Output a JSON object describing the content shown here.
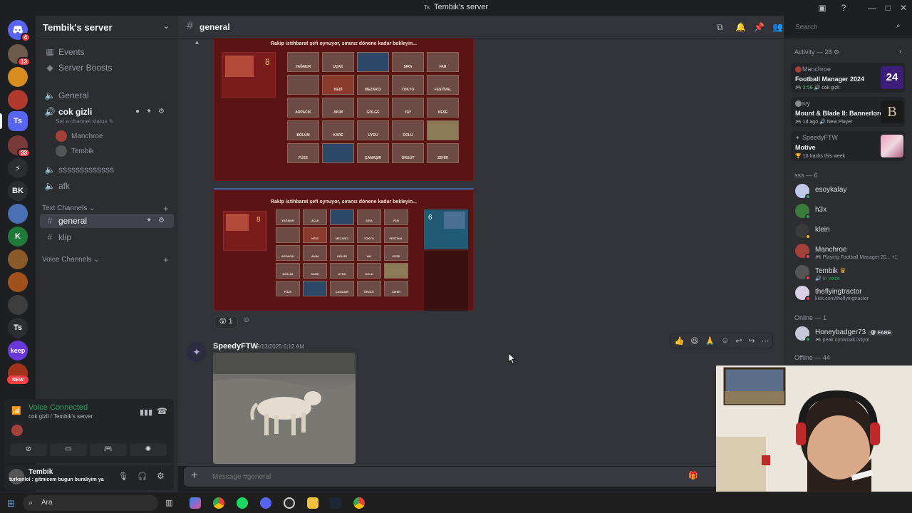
{
  "window": {
    "title": "Tembik's server",
    "title_icon": "Ts"
  },
  "rail": {
    "servers": [
      {
        "name": "discord-home",
        "badge": "4"
      },
      {
        "name": "server-2",
        "badge": "13"
      },
      {
        "name": "server-3"
      },
      {
        "name": "server-4"
      },
      {
        "name": "Ts",
        "label": "Ts"
      },
      {
        "name": "server-6",
        "badge": "33"
      },
      {
        "name": "server-7"
      },
      {
        "name": "BK",
        "label": "BK"
      },
      {
        "name": "server-9"
      },
      {
        "name": "server-10",
        "label": "K"
      },
      {
        "name": "server-11"
      },
      {
        "name": "server-12"
      },
      {
        "name": "server-13"
      },
      {
        "name": "Ts2",
        "label": "Ts"
      },
      {
        "name": "keep",
        "label": "keep"
      },
      {
        "name": "server-16",
        "badge": "NEW"
      }
    ]
  },
  "server": {
    "name": "Tembik's server"
  },
  "channels": {
    "events": "Events",
    "boosts": "Server Boosts",
    "voice_general": "General",
    "voice_cok_gizli": "cok gizli",
    "status_hint": "Set a channel status",
    "voice_users": [
      "Manchroe",
      "Tembik"
    ],
    "voice_sss": "sssssssssssss",
    "voice_afk": "afk",
    "text_category": "Text Channels",
    "text_general": "general",
    "text_klip": "klip",
    "voice_category": "Voice Channels"
  },
  "voice_panel": {
    "status": "Voice Connected",
    "location": "cok gizli / Tembik's server"
  },
  "user_panel": {
    "username": "Tembik",
    "status": "turkanlol : gitmicem bugun buraliyim ya"
  },
  "header": {
    "channel": "general"
  },
  "search": {
    "placeholder": "Search"
  },
  "game": {
    "banner": "Rakip istihbarat şefi oynuyor, sıranız dönene kadar bekleyin...",
    "score_1": "8",
    "score_2": "8",
    "score_3": "6",
    "cards": [
      "YAĞMUR",
      "UÇAK",
      "",
      "SIRA",
      "FAR",
      "",
      "KEDİ",
      "MEZARCI",
      "TOKYO",
      "FESTİVAL",
      "ARPACIK",
      "AKIM",
      "GÖLGE",
      "YAY",
      "KESE",
      "BÖLÜM",
      "KARE",
      "UYDU",
      "DOLU",
      "",
      "FÜZE",
      "",
      "ÇAMAŞIR",
      "ÖRGÜT",
      "ZEHİR"
    ]
  },
  "reaction": {
    "emoji": "😲",
    "count": "1"
  },
  "message": {
    "author": "SpeedyFTW",
    "timestamp": "9/13/2025 6:12 AM"
  },
  "toolbar": {
    "emojis": [
      "👍",
      "😆",
      "🙏"
    ]
  },
  "composer": {
    "placeholder": "Message #general"
  },
  "activity": {
    "header": "Activity — 28",
    "cards": [
      {
        "user": "Manchroe",
        "title": "Football Manager 2024",
        "sub_time": "3:56",
        "sub_extra": "cok gizli",
        "art": "24"
      },
      {
        "user": "ivy",
        "title": "Mount & Blade II: Bannerlord",
        "sub_time": "1d ago",
        "sub_extra": "New Player",
        "art": "B"
      },
      {
        "user": "SpeedyFTW",
        "title": "Motive",
        "sub_extra": "10 tracks this week"
      }
    ],
    "section_sss": "sss — 6",
    "members_sss": [
      {
        "name": "esoykalay",
        "status": ""
      },
      {
        "name": "h3x",
        "status": ""
      },
      {
        "name": "klein",
        "status": ""
      },
      {
        "name": "Manchroe",
        "status": "Playing Football Manager 20...",
        "extra": "+1"
      },
      {
        "name": "Tembik",
        "status": "In voice"
      },
      {
        "name": "theflyingtractor",
        "status": "kick.com/theflyingtractor"
      }
    ],
    "section_online": "Online — 1",
    "members_online": [
      {
        "name": "Honeybadger73",
        "tag": "FARE",
        "status": "peak oynamak istiyor"
      }
    ],
    "section_offline": "Offline — 44"
  },
  "taskbar": {
    "search": "Ara"
  },
  "colors": {
    "accent": "#5865f2",
    "online": "#23a55a",
    "dnd": "#f23f43",
    "idle": "#f0b232"
  }
}
